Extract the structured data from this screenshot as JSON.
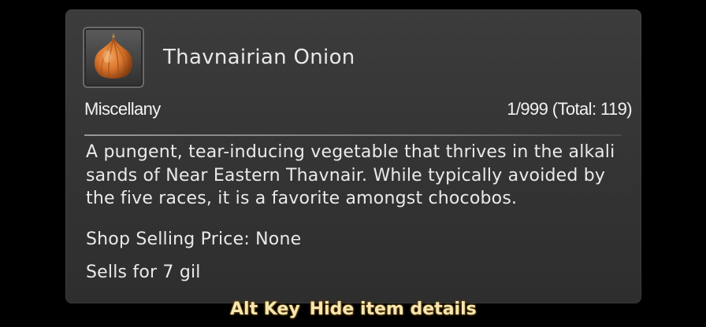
{
  "item": {
    "name": "Thavnairian Onion",
    "icon": "onion-icon",
    "category": "Miscellany",
    "stack": "1/999 (Total: 119)",
    "description": "A pungent, tear-inducing vegetable that thrives in the alkali sands of Near Eastern Thavnair. While typically avoided by the five races, it is a favorite amongst chocobos.",
    "shop_price": "Shop Selling Price: None",
    "sells_for": "Sells for 7 gil"
  },
  "hint": {
    "key": "Alt Key",
    "action": "Hide item details"
  },
  "colors": {
    "panel": "#353535",
    "text": "#eaeaea",
    "hint_text": "#f5e6b0",
    "onion": "#d9742b"
  }
}
